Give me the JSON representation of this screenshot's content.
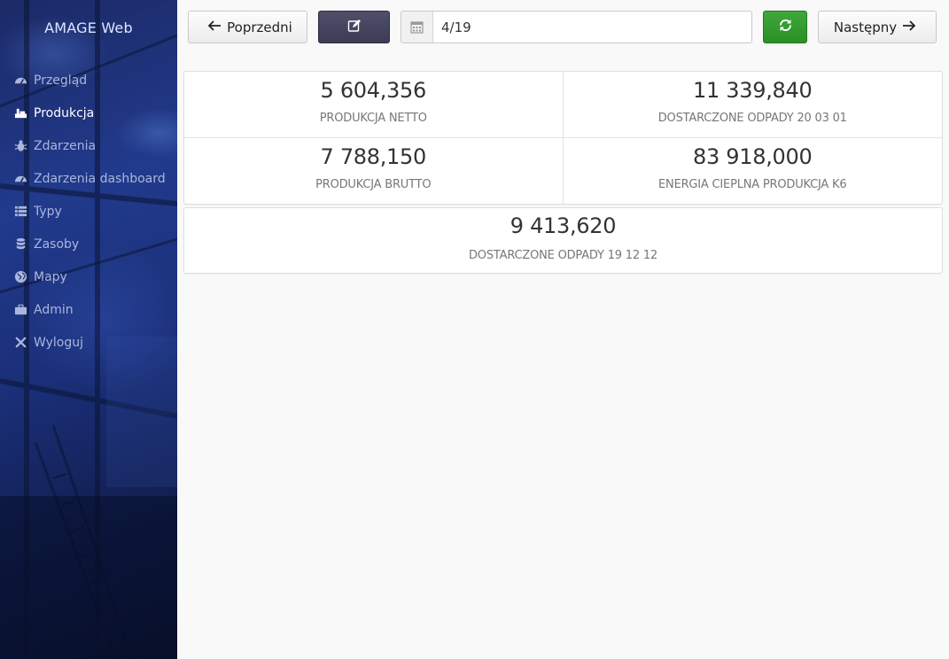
{
  "app": {
    "title": "AMAGE Web"
  },
  "sidebar": {
    "items": [
      {
        "label": "Przegląd",
        "icon": "dashboard-icon",
        "active": false
      },
      {
        "label": "Produkcja",
        "icon": "factory-icon",
        "active": true
      },
      {
        "label": "Zdarzenia",
        "icon": "bug-icon",
        "active": false
      },
      {
        "label": "Zdarzenia dashboard",
        "icon": "dashboard-icon",
        "active": false
      },
      {
        "label": "Typy",
        "icon": "list-icon",
        "active": false
      },
      {
        "label": "Zasoby",
        "icon": "database-icon",
        "active": false
      },
      {
        "label": "Mapy",
        "icon": "globe-icon",
        "active": false
      },
      {
        "label": "Admin",
        "icon": "briefcase-icon",
        "active": false
      },
      {
        "label": "Wyloguj",
        "icon": "close-icon",
        "active": false
      }
    ]
  },
  "toolbar": {
    "prev_label": "Poprzedni",
    "next_label": "Następny",
    "edit_icon": "edit-icon",
    "refresh_icon": "refresh-icon",
    "date_icon": "calendar-icon",
    "date_value": "4/19"
  },
  "stats": [
    {
      "value": "5 604,356",
      "label": "PRODUKCJA NETTO"
    },
    {
      "value": "11 339,840",
      "label": "DOSTARCZONE ODPADY 20 03 01"
    },
    {
      "value": "7 788,150",
      "label": "PRODUKCJA BRUTTO"
    },
    {
      "value": "83 918,000",
      "label": "ENERGIA CIEPLNA PRODUKCJA K6"
    },
    {
      "value": "9 413,620",
      "label": "DOSTARCZONE ODPADY 19 12 12"
    }
  ],
  "colors": {
    "sidebar_bg": "#1c2a66",
    "edit_button": "#44445e",
    "refresh_button": "#34a02f",
    "page_bg": "#f9f9f9"
  }
}
